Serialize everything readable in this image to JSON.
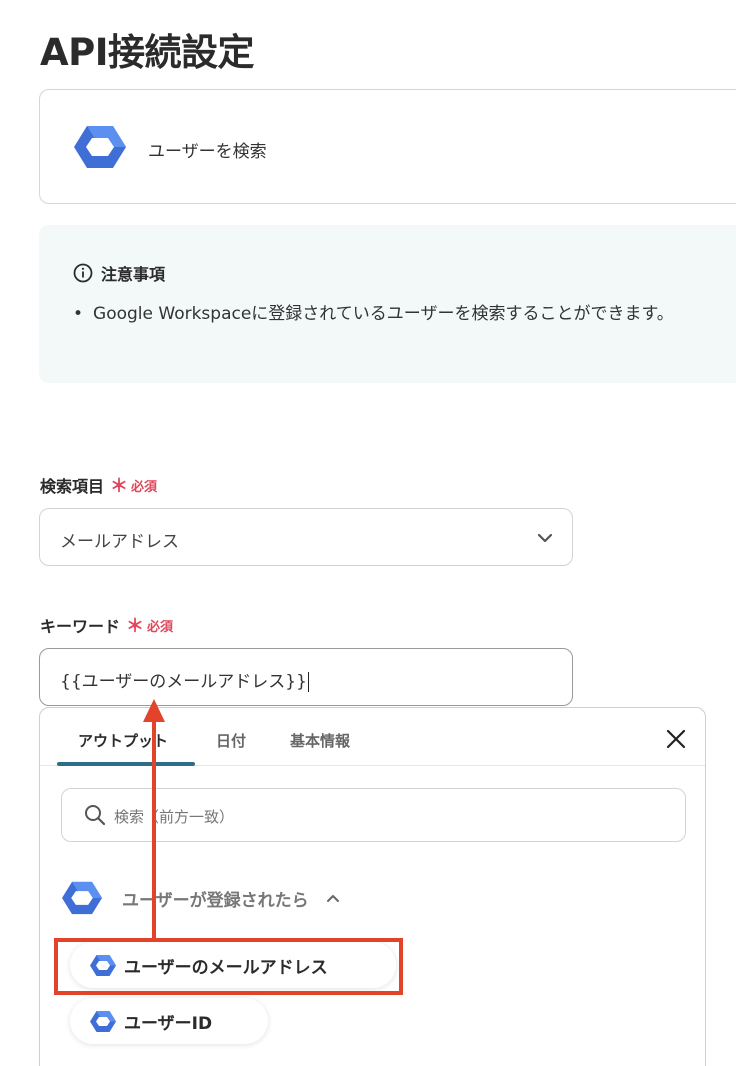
{
  "page": {
    "title": "API接続設定"
  },
  "action_card": {
    "label": "ユーザーを検索"
  },
  "notice": {
    "heading": "注意事項",
    "bullets": [
      "Google Workspaceに登録されているユーザーを検索することができます。"
    ]
  },
  "search_field": {
    "label": "検索項目",
    "required_mark": "＊",
    "required_text": "必須",
    "selected_value": "メールアドレス"
  },
  "keyword_field": {
    "label": "キーワード",
    "required_mark": "＊",
    "required_text": "必須",
    "value": "{{ユーザーのメールアドレス}}"
  },
  "panel": {
    "tabs": [
      {
        "label": "アウトプット",
        "active": true
      },
      {
        "label": "日付",
        "active": false
      },
      {
        "label": "基本情報",
        "active": false
      }
    ],
    "search_placeholder": "検索（前方一致）",
    "group": {
      "title": "ユーザーが登録されたら",
      "items": [
        {
          "label": "ユーザーのメールアドレス",
          "highlighted": true
        },
        {
          "label": "ユーザーID",
          "highlighted": false
        }
      ]
    }
  },
  "colors": {
    "accent_tab": "#2d6e86",
    "required": "#e0475c",
    "annotation": "#e3432a",
    "logo_blue": "#4a7fe0"
  },
  "icons": [
    "hexagon-logo-icon",
    "info-icon",
    "chevron-down-icon",
    "close-icon",
    "search-icon",
    "chevron-up-icon"
  ]
}
